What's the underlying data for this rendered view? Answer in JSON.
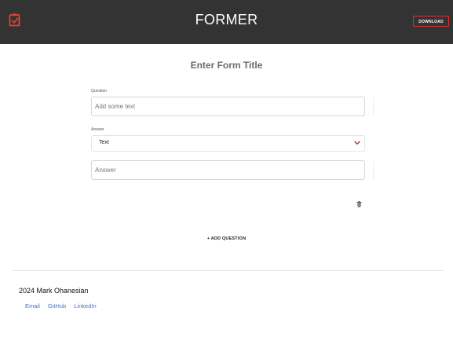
{
  "header": {
    "app_title": "FORMER",
    "download_label": "DOWNLOAD",
    "logo_icon": "clipboard-check-icon",
    "accent_color": "#d9302c",
    "bar_color": "#333333"
  },
  "form": {
    "title": "Enter Form Title",
    "question": {
      "label": "Question",
      "value": "",
      "placeholder": "Add some text"
    },
    "answer_type": {
      "label": "Answer",
      "selected": "Text"
    },
    "answer": {
      "value": "",
      "placeholder": "Answer"
    },
    "delete_icon": "trash-icon",
    "add_question_label": "+ ADD QUESTION"
  },
  "footer": {
    "copyright": "2024 Mark Ohanesian",
    "links": [
      "Email",
      "GitHub",
      "LinkedIn"
    ],
    "link_color": "#4a74c9"
  }
}
